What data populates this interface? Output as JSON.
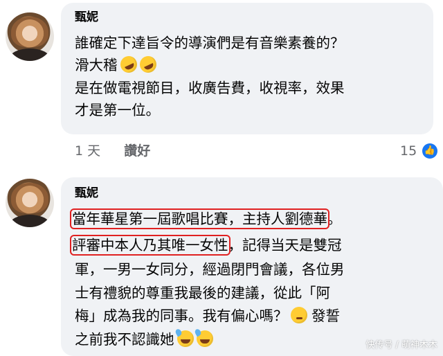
{
  "comment1": {
    "author": "甄妮",
    "lines": [
      "誰確定下達旨令的導演們是有音樂素養的？",
      "滑大稽",
      "是在做電視節目，收廣告費，收視率，效果",
      "才是第一位。"
    ],
    "emoji": [
      "rolling-on-floor-laughing",
      "rolling-on-floor-laughing"
    ],
    "time": "1 天",
    "like_label": "讚好",
    "reaction_count": "15",
    "reaction_icon": "thumbs-up-icon"
  },
  "comment2": {
    "author": "甄妮",
    "line1_highlight": "當年華星第一屆歌唱比賽，主持人劉德華",
    "line1_tail": "。",
    "line2_highlight": "評審中本人乃其唯一女性",
    "line2_tail": "，記得当天是雙冠",
    "line3": "軍，一男一女同分，經過閉門會議，各位男",
    "line4": "士有禮貌的尊重我最後的建議，從此「阿",
    "line5": "梅」成為我的同事。我有偏心嗎？",
    "line5_tail": "發誓",
    "line6": "之前我不認識她",
    "emoji": [
      "thinking-face",
      "grinning-sweat",
      "grinning-sweat"
    ],
    "highlight_color": "#e02020"
  },
  "watermark": "快传号 / 萌神木木"
}
